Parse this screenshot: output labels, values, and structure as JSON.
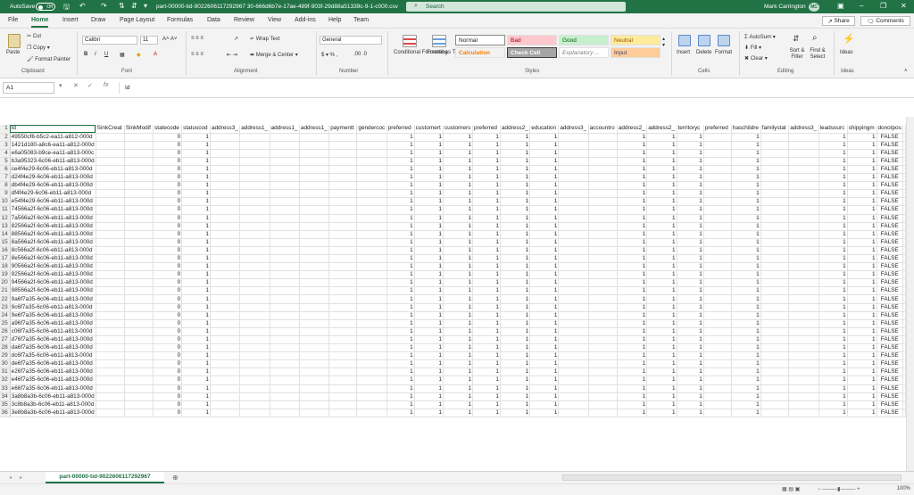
{
  "titlebar": {
    "autosave": "AutoSave",
    "autosave_state": "Off",
    "filename": "part-00000-tid-9022606117292967 30-666d6b7e-17ae-489f-903f-29d88a51339c-9-1-c000.csv",
    "search_placeholder": "Search",
    "user": "Mark Carrington",
    "initials": "MC"
  },
  "tabs": [
    "File",
    "Home",
    "Insert",
    "Draw",
    "Page Layout",
    "Formulas",
    "Data",
    "Review",
    "View",
    "Add-ins",
    "Help",
    "Team"
  ],
  "share": "Share",
  "comments": "Comments",
  "ribbon": {
    "clipboard": {
      "paste": "Paste",
      "cut": "Cut",
      "copy": "Copy",
      "painter": "Format Painter",
      "label": "Clipboard"
    },
    "font": {
      "name": "Calibri",
      "size": "11",
      "label": "Font"
    },
    "alignment": {
      "wrap": "Wrap Text",
      "merge": "Merge & Center",
      "label": "Alignment"
    },
    "number": {
      "format": "General",
      "label": "Number"
    },
    "styles": {
      "cond": "Conditional Formatting",
      "table": "Format as Table",
      "cells": [
        "Normal",
        "Bad",
        "Good",
        "Neutral",
        "Calculation",
        "Check Cell",
        "Explanatory ...",
        "Input"
      ],
      "label": "Styles"
    },
    "cells": {
      "insert": "Insert",
      "delete": "Delete",
      "format": "Format",
      "label": "Cells"
    },
    "editing": {
      "autosum": "AutoSum",
      "fill": "Fill",
      "clear": "Clear",
      "sort": "Sort & Filter",
      "find": "Find & Select",
      "label": "Editing"
    },
    "ideas": {
      "ideas": "Ideas",
      "label": "Ideas"
    }
  },
  "formula_bar": {
    "cell": "A1",
    "fx": "fx",
    "content": "Id"
  },
  "columns": [
    "A",
    "B",
    "C",
    "D",
    "E",
    "F",
    "G",
    "H",
    "I",
    "J",
    "K",
    "L",
    "M",
    "N",
    "O",
    "P",
    "Q",
    "R",
    "S",
    "T",
    "U",
    "V",
    "W",
    "X",
    "Y",
    "Z",
    "AA",
    "AB",
    "AC"
  ],
  "headers": [
    "Id",
    "SinkCreat",
    "SinkModif",
    "statecode",
    "statuscod",
    "address3_",
    "address1_",
    "address1_",
    "address1_",
    "paymentt",
    "gendercoc",
    "preferred",
    "customert",
    "customers",
    "preferred",
    "address2_",
    "education",
    "address3_",
    "accountro",
    "address2_",
    "address2_",
    "territoryc",
    "preferred",
    "haschildre",
    "familystat",
    "address3_",
    "leadsourc",
    "shippingm",
    "donotpos"
  ],
  "ids": [
    "49550cf6-b5c2-ea11-a812-000d",
    "1421d180-a8c6-ea11-a812-000d",
    "e6a05083-b9ce-ea11-a813-000c",
    "b3a95323-6c06-eb11-a813-000d",
    "ce4f4e29-6c06-eb11-a813-000d",
    "d24f4e29-6c06-eb11-a813-000d",
    "db4f4e29-6c06-eb11-a813-000d",
    "df4f4e29-6c06-eb11-a813-000d",
    "e54f4e29-6c06-eb11-a813-000d",
    "74566a2f-6c06-eb11-a813-000d",
    "7a566a2f-6c06-eb11-a813-000d",
    "82566a2f-6c06-eb11-a813-000d",
    "88566a2f-6c06-eb11-a813-000d",
    "8a566a2f-6c06-eb11-a813-000d",
    "8c566a2f-6c06-eb11-a813-000d",
    "8e566a2f-6c06-eb11-a813-000d",
    "90566a2f-6c06-eb11-a813-000d",
    "92566a2f-6c06-eb11-a813-000d",
    "94566a2f-6c06-eb11-a813-000d",
    "98566a2f-6c06-eb11-a813-000d",
    "9a6f7a35-6c06-eb11-a813-000d",
    "9c6f7a35-6c06-eb11-a813-000d",
    "9e6f7a35-6c06-eb11-a813-000d",
    "a96f7a35-6c06-eb11-a813-000d",
    "c06f7a35-6c06-eb11-a813-000d",
    "d76f7a35-6c06-eb11-a813-000d",
    "da6f7a35-6c06-eb11-a813-000d",
    "dc6f7a35-6c06-eb11-a813-000d",
    "de6f7a35-6c06-eb11-a813-000d",
    "e26f7a35-6c06-eb11-a813-000d",
    "e46f7a35-6c06-eb11-a813-000d",
    "e66f7a35-6c06-eb11-a813-000d",
    "3a8b8a3b-6c06-eb11-a813-000d",
    "3c8b8a3b-6c06-eb11-a813-000d",
    "3e8b8a3b-6c06-eb11-a813-000d"
  ],
  "row_values": {
    "D": "0",
    "E": "1",
    "L": "1",
    "M": "1",
    "N": "1",
    "O": "1",
    "P": "1",
    "Q": "1",
    "T": "1",
    "U": "1",
    "V": "1",
    "X": "1",
    "AA": "1",
    "AB": "1",
    "AC": "FALSE"
  },
  "sheet_tab": "part-00000-tid-9022606117292967",
  "zoom": "100%"
}
